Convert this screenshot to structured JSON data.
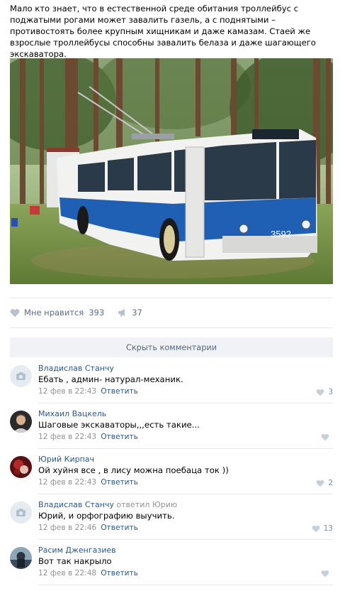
{
  "post": {
    "text": "Мало кто знает, что в естественной среде обитания троллейбус с поджатыми рогами может завалить газель, а с поднятыми – противостоять более крупным хищникам и даже камазам. Стаей же взрослые троллейбусы способны завалить белаза и даже шагающего экскаватора.",
    "bus_number": "3592"
  },
  "actions": {
    "like_label": "Мне нравится",
    "like_count": "393",
    "share_count": "37"
  },
  "hide_comments_label": "Скрыть комментарии",
  "comments": [
    {
      "author": "Владислав Станчу",
      "reply_to": "",
      "text": "Ебать , админ- натурал-механик.",
      "date": "12 фев в 22:43",
      "reply": "Ответить",
      "likes": "3",
      "avatar": "camera-placeholder"
    },
    {
      "author": "Михаил Вацкель",
      "reply_to": "",
      "text": "Шаговые экскаваторы,,,есть такие...",
      "date": "12 фев в 22:43",
      "reply": "Ответить",
      "likes": "",
      "avatar": "photo"
    },
    {
      "author": "Юрий Кирпач",
      "reply_to": "",
      "text": "Ой хуйня все , в лису можна поебаца ток ))",
      "date": "12 фев в 22:43",
      "reply": "Ответить",
      "likes": "2",
      "avatar": "photo"
    },
    {
      "author": "Владислав Станчу",
      "reply_to": "ответил Юрию",
      "text": "Юрий, и орфографию выучить.",
      "date": "12 фев в 22:46",
      "reply": "Ответить",
      "likes": "13",
      "avatar": "camera-placeholder"
    },
    {
      "author": "Расим Дженгазиев",
      "reply_to": "",
      "text": "Вот так накрыло",
      "date": "12 фев в 22:48",
      "reply": "Ответить",
      "likes": "",
      "avatar": "photo"
    }
  ],
  "colors": {
    "link": "#2a5885",
    "meta": "#939393",
    "action": "#5b6d85",
    "hide_bg": "#f0f2f5",
    "bus_blue": "#1f5fb4"
  }
}
